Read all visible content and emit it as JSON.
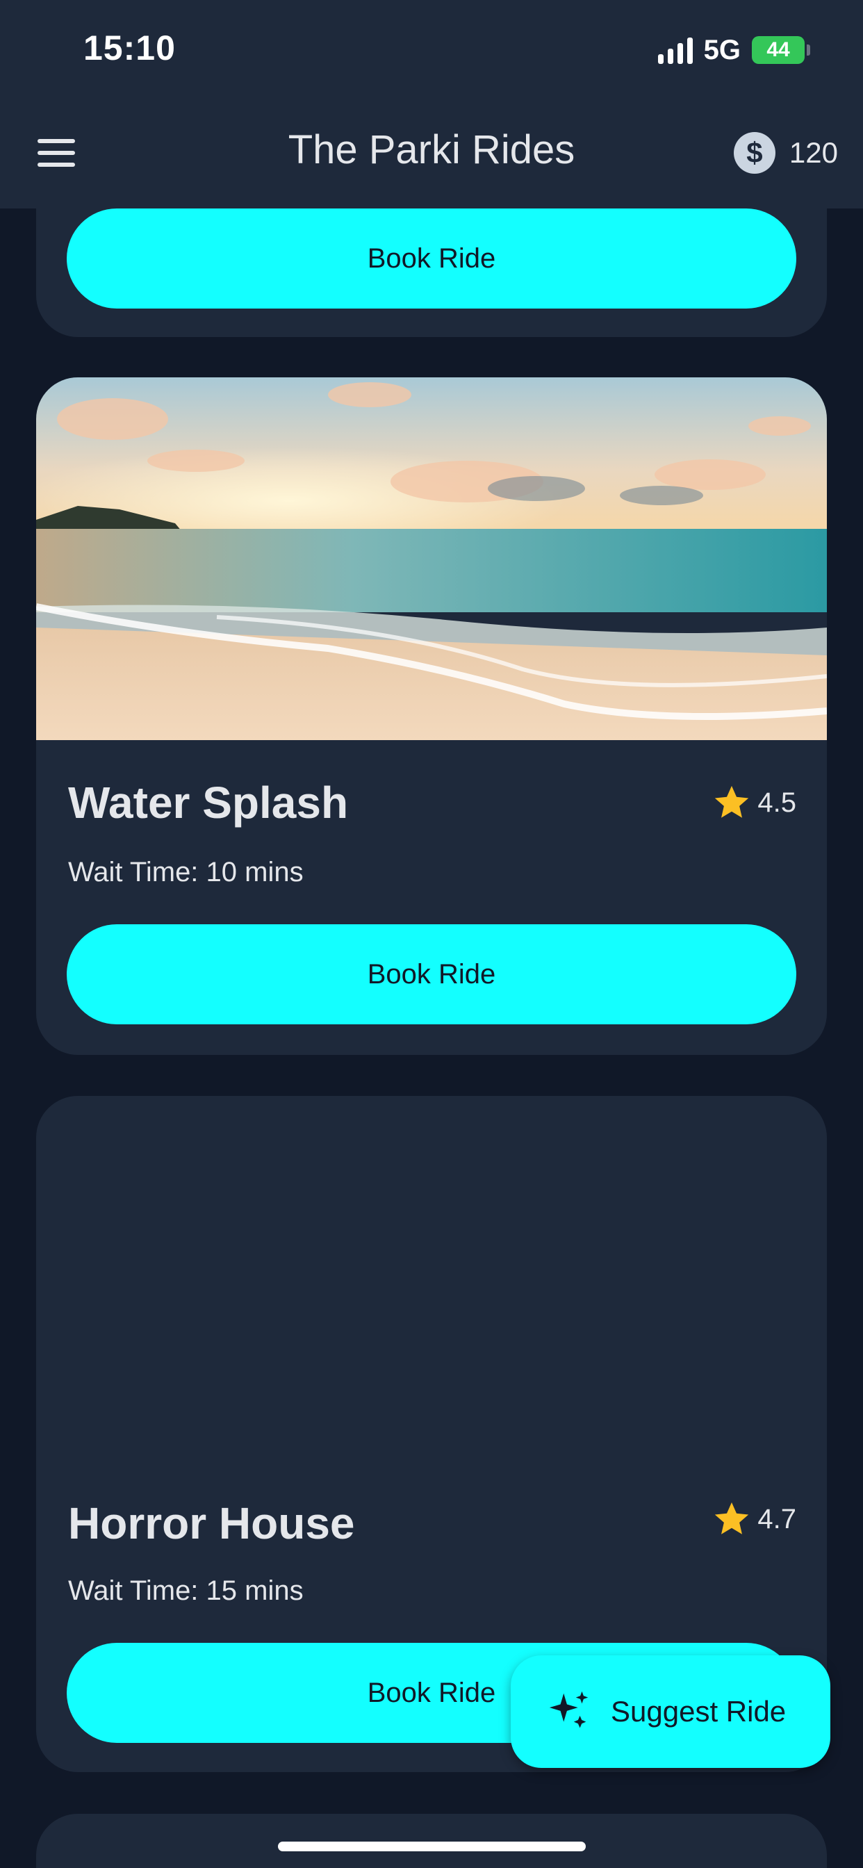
{
  "status_bar": {
    "time": "15:10",
    "network": "5G",
    "battery": "44"
  },
  "app_bar": {
    "title": "The Parki Rides",
    "coin_icon": "dollar-coin-icon",
    "coins": "120"
  },
  "rides": [
    {
      "book_label": "Book Ride"
    },
    {
      "name": "Water Splash",
      "rating": "4.5",
      "wait": "Wait Time: 10 mins",
      "book_label": "Book Ride",
      "image": "beach-sunset-photo"
    },
    {
      "name": "Horror House",
      "rating": "4.7",
      "wait": "Wait Time: 15 mins",
      "book_label": "Book Ride"
    }
  ],
  "fab": {
    "label": "Suggest Ride",
    "icon": "sparkles-icon"
  },
  "colors": {
    "accent": "#13ffff",
    "card": "#1e293b",
    "background": "#101828",
    "star": "#fbbf24"
  }
}
